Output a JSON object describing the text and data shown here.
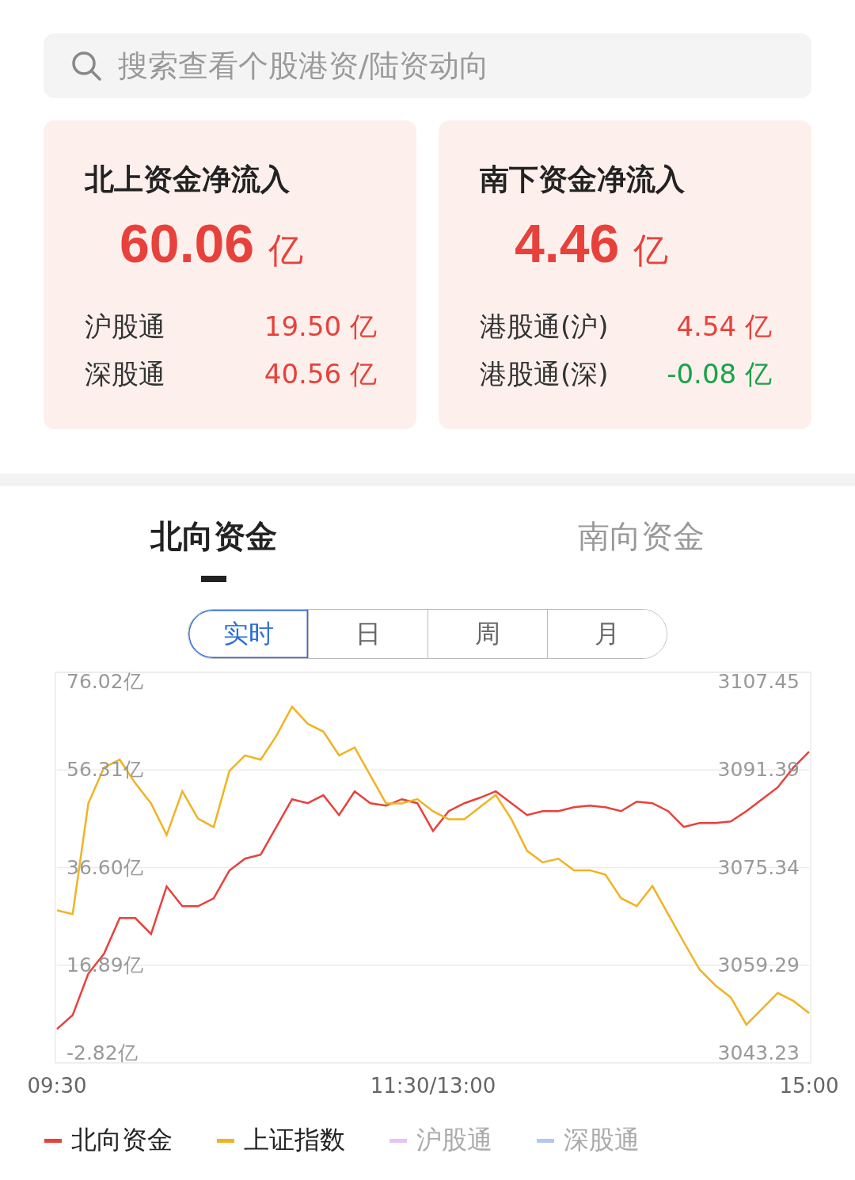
{
  "search": {
    "placeholder": "搜索查看个股港资/陆资动向"
  },
  "flow_cards": [
    {
      "title": "北上资金净流入",
      "amount": "60.06",
      "unit": "亿",
      "color": "#e8413c",
      "rows": [
        {
          "label": "沪股通",
          "amount": "19.50",
          "unit": "亿",
          "color": "#e8413c"
        },
        {
          "label": "深股通",
          "amount": "40.56",
          "unit": "亿",
          "color": "#e8413c"
        }
      ]
    },
    {
      "title": "南下资金净流入",
      "amount": "4.46",
      "unit": "亿",
      "color": "#e8413c",
      "rows": [
        {
          "label": "港股通(沪)",
          "amount": "4.54",
          "unit": "亿",
          "color": "#e8413c"
        },
        {
          "label": "港股通(深)",
          "amount": "-0.08",
          "unit": "亿",
          "color": "#1aa34a"
        }
      ]
    }
  ],
  "tabs": [
    {
      "label": "北向资金",
      "selected": true
    },
    {
      "label": "南向资金",
      "selected": false
    }
  ],
  "periods": [
    {
      "label": "实时",
      "selected": true
    },
    {
      "label": "日",
      "selected": false
    },
    {
      "label": "周",
      "selected": false
    },
    {
      "label": "月",
      "selected": false
    }
  ],
  "chart": {
    "chart_data": {
      "type": "line",
      "categories": [
        "09:30",
        null,
        null,
        null,
        null,
        null,
        null,
        null,
        null,
        null,
        null,
        null,
        null,
        null,
        null,
        null,
        null,
        null,
        null,
        null,
        null,
        null,
        null,
        null,
        "11:30/13:00",
        null,
        null,
        null,
        null,
        null,
        null,
        null,
        null,
        null,
        null,
        null,
        null,
        null,
        null,
        null,
        null,
        null,
        null,
        null,
        null,
        null,
        null,
        null,
        "15:00"
      ],
      "grid": true,
      "ylim": [
        -2.82,
        76.02
      ],
      "yticks": [
        {
          "value": 76.02,
          "label": "76.02亿"
        },
        {
          "value": 56.31,
          "label": "56.31亿"
        },
        {
          "value": 36.6,
          "label": "36.60亿"
        },
        {
          "value": 16.89,
          "label": "16.89亿"
        },
        {
          "value": -2.82,
          "label": "-2.82亿"
        }
      ],
      "y2lim": [
        3043.23,
        3107.45
      ],
      "y2ticks": [
        {
          "value": 3107.45,
          "label": "3107.45"
        },
        {
          "value": 3091.39,
          "label": "3091.39"
        },
        {
          "value": 3075.34,
          "label": "3075.34"
        },
        {
          "value": 3059.29,
          "label": "3059.29"
        },
        {
          "value": 3043.23,
          "label": "3043.23"
        }
      ],
      "series": [
        {
          "color": "#e8413c",
          "values": [
            4.0,
            6.8,
            15.2,
            19.2,
            26.4,
            26.4,
            23.2,
            32.8,
            28.8,
            28.8,
            30.4,
            36.0,
            38.4,
            39.2,
            44.8,
            50.4,
            49.6,
            51.2,
            47.2,
            52.0,
            49.6,
            49.1,
            50.4,
            49.6,
            44.0,
            48.0,
            49.6,
            50.7,
            52.0,
            49.6,
            47.2,
            48.0,
            48.0,
            48.8,
            49.1,
            48.8,
            48.0,
            49.9,
            49.6,
            48.0,
            44.8,
            45.6,
            45.6,
            45.9,
            48.0,
            50.4,
            52.8,
            56.8,
            60.0
          ]
        },
        {
          "color": "#f0b323",
          "axis": "y2",
          "values": [
            3068.3,
            3067.7,
            3085.9,
            3091.8,
            3093.1,
            3089.2,
            3085.9,
            3080.7,
            3087.9,
            3083.4,
            3082.0,
            3091.2,
            3093.8,
            3093.1,
            3097.0,
            3101.8,
            3099.0,
            3097.7,
            3093.8,
            3095.1,
            3090.5,
            3085.9,
            3085.9,
            3086.6,
            3084.6,
            3083.3,
            3083.3,
            3085.3,
            3087.3,
            3083.3,
            3078.1,
            3076.2,
            3076.8,
            3074.9,
            3074.9,
            3074.2,
            3070.3,
            3069.0,
            3072.3,
            3067.7,
            3063.1,
            3058.6,
            3056.0,
            3054.0,
            3049.5,
            3052.1,
            3054.7,
            3053.4,
            3051.4
          ]
        }
      ]
    }
  },
  "legend": [
    {
      "label": "北向资金",
      "color": "#e8413c",
      "on": true
    },
    {
      "label": "上证指数",
      "color": "#f0b323",
      "on": true
    },
    {
      "label": "沪股通",
      "color": "#e3c6f3",
      "on": false
    },
    {
      "label": "深股通",
      "color": "#b3c8f1",
      "on": false
    }
  ]
}
